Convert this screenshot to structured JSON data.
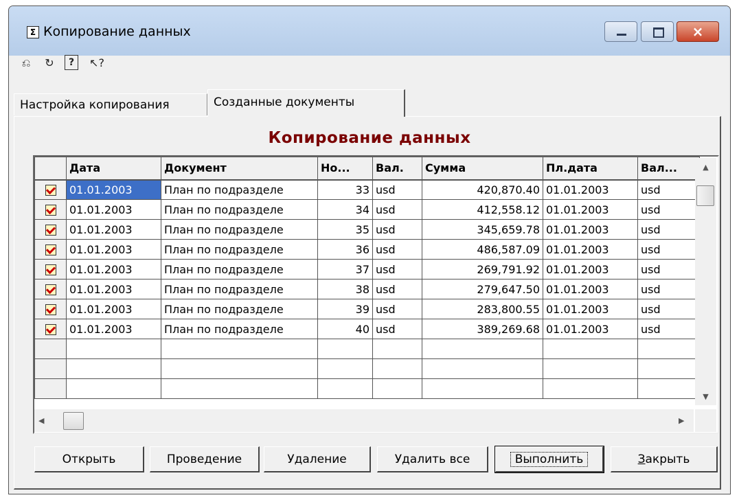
{
  "window": {
    "title": "Копирование данных",
    "app_icon_glyph": "Σ",
    "controls": {
      "minimize": "minimize-icon",
      "maximize": "maximize-icon",
      "close": "×"
    }
  },
  "toolbar": {
    "items": [
      {
        "icon": "undo-icon",
        "glyph": "⎌"
      },
      {
        "icon": "redo-icon",
        "glyph": "↻"
      },
      {
        "icon": "help-icon",
        "glyph": "?"
      },
      {
        "icon": "context-help-icon",
        "glyph": "↖?"
      }
    ]
  },
  "tabs": [
    {
      "label": "Настройка копирования",
      "active": false
    },
    {
      "label": "Созданные документы",
      "active": true
    }
  ],
  "panel": {
    "title": "Копирование данных"
  },
  "grid": {
    "columns": [
      "Дата",
      "Документ",
      "Но...",
      "Вал.",
      "Сумма",
      "Пл.дата",
      "Вал..."
    ],
    "rows": [
      {
        "date": "01.01.2003",
        "document": "План по подразделе",
        "number": "33",
        "currency": "usd",
        "amount": "420,870.40",
        "pay_date": "01.01.2003",
        "currency2": "usd"
      },
      {
        "date": "01.01.2003",
        "document": "План по подразделе",
        "number": "34",
        "currency": "usd",
        "amount": "412,558.12",
        "pay_date": "01.01.2003",
        "currency2": "usd"
      },
      {
        "date": "01.01.2003",
        "document": "План по подразделе",
        "number": "35",
        "currency": "usd",
        "amount": "345,659.78",
        "pay_date": "01.01.2003",
        "currency2": "usd"
      },
      {
        "date": "01.01.2003",
        "document": "План по подразделе",
        "number": "36",
        "currency": "usd",
        "amount": "486,587.09",
        "pay_date": "01.01.2003",
        "currency2": "usd"
      },
      {
        "date": "01.01.2003",
        "document": "План по подразделе",
        "number": "37",
        "currency": "usd",
        "amount": "269,791.92",
        "pay_date": "01.01.2003",
        "currency2": "usd"
      },
      {
        "date": "01.01.2003",
        "document": "План по подразделе",
        "number": "38",
        "currency": "usd",
        "amount": "279,647.50",
        "pay_date": "01.01.2003",
        "currency2": "usd"
      },
      {
        "date": "01.01.2003",
        "document": "План по подразделе",
        "number": "39",
        "currency": "usd",
        "amount": "283,800.55",
        "pay_date": "01.01.2003",
        "currency2": "usd"
      },
      {
        "date": "01.01.2003",
        "document": "План по подразделе",
        "number": "40",
        "currency": "usd",
        "amount": "389,269.68",
        "pay_date": "01.01.2003",
        "currency2": "usd"
      }
    ],
    "empty_rows": 3,
    "selected_cell": {
      "row": 0,
      "column": "date"
    },
    "selection_color": "#3d6fc7"
  },
  "buttons": [
    {
      "label": "Открыть",
      "default": false
    },
    {
      "label": "Проведение",
      "default": false
    },
    {
      "label": "Удаление",
      "default": false
    },
    {
      "label": "Удалить все",
      "default": false
    },
    {
      "label": "Выполнить",
      "default": true
    },
    {
      "label": "Закрыть",
      "default": false,
      "mnemonic_index": 0
    }
  ],
  "colors": {
    "title_bar": "#b6cde9",
    "panel_title": "#7a0000",
    "close_button": "#c9452a"
  }
}
